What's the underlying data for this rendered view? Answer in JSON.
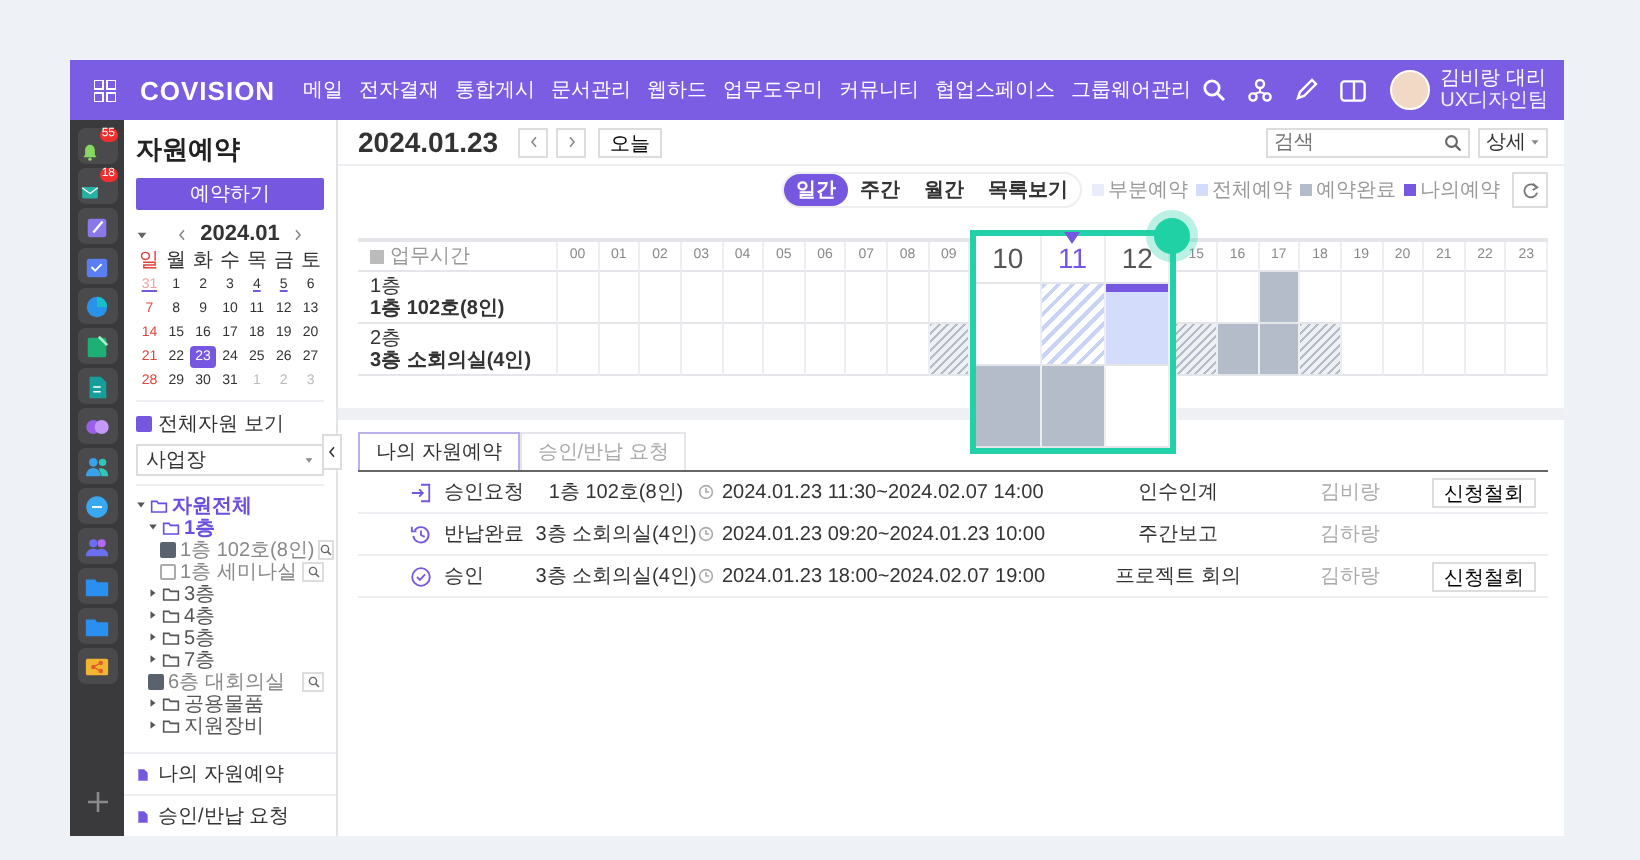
{
  "topbar": {
    "logo": "COVISION",
    "menu": [
      "메일",
      "전자결재",
      "통합게시",
      "문서관리",
      "웹하드",
      "업무도우미",
      "커뮤니티",
      "협업스페이스",
      "그룹웨어관리"
    ],
    "user_name": "김비랑 대리",
    "user_team": "UX디자인팀"
  },
  "rail": {
    "badges": [
      "55",
      "18"
    ]
  },
  "sidebar": {
    "title": "자원예약",
    "reserve_button": "예약하기",
    "calendar": {
      "month": "2024.01",
      "weekdays": [
        "일",
        "월",
        "화",
        "수",
        "목",
        "금",
        "토"
      ],
      "weeks": [
        [
          {
            "day": "31",
            "muted": true,
            "marked": true,
            "selected": false
          },
          {
            "day": "1",
            "muted": false,
            "marked": false,
            "selected": false
          },
          {
            "day": "2",
            "muted": false,
            "marked": false,
            "selected": false
          },
          {
            "day": "3",
            "muted": false,
            "marked": false,
            "selected": false
          },
          {
            "day": "4",
            "muted": false,
            "marked": true,
            "selected": false
          },
          {
            "day": "5",
            "muted": false,
            "marked": true,
            "selected": false
          },
          {
            "day": "6",
            "muted": false,
            "marked": false,
            "selected": false
          }
        ],
        [
          {
            "day": "7",
            "muted": false,
            "marked": false,
            "selected": false
          },
          {
            "day": "8",
            "muted": false,
            "marked": false,
            "selected": false
          },
          {
            "day": "9",
            "muted": false,
            "marked": false,
            "selected": false
          },
          {
            "day": "10",
            "muted": false,
            "marked": false,
            "selected": false
          },
          {
            "day": "11",
            "muted": false,
            "marked": false,
            "selected": false
          },
          {
            "day": "12",
            "muted": false,
            "marked": false,
            "selected": false
          },
          {
            "day": "13",
            "muted": false,
            "marked": false,
            "selected": false
          }
        ],
        [
          {
            "day": "14",
            "muted": false,
            "marked": false,
            "selected": false
          },
          {
            "day": "15",
            "muted": false,
            "marked": false,
            "selected": false
          },
          {
            "day": "16",
            "muted": false,
            "marked": false,
            "selected": false
          },
          {
            "day": "17",
            "muted": false,
            "marked": false,
            "selected": false
          },
          {
            "day": "18",
            "muted": false,
            "marked": false,
            "selected": false
          },
          {
            "day": "19",
            "muted": false,
            "marked": false,
            "selected": false
          },
          {
            "day": "20",
            "muted": false,
            "marked": false,
            "selected": false
          }
        ],
        [
          {
            "day": "21",
            "muted": false,
            "marked": false,
            "selected": false
          },
          {
            "day": "22",
            "muted": false,
            "marked": false,
            "selected": false
          },
          {
            "day": "23",
            "muted": false,
            "marked": false,
            "selected": true
          },
          {
            "day": "24",
            "muted": false,
            "marked": false,
            "selected": false
          },
          {
            "day": "25",
            "muted": false,
            "marked": false,
            "selected": false
          },
          {
            "day": "26",
            "muted": false,
            "marked": false,
            "selected": false
          },
          {
            "day": "27",
            "muted": false,
            "marked": false,
            "selected": false
          }
        ],
        [
          {
            "day": "28",
            "muted": false,
            "marked": false,
            "selected": false
          },
          {
            "day": "29",
            "muted": false,
            "marked": false,
            "selected": false
          },
          {
            "day": "30",
            "muted": false,
            "marked": false,
            "selected": false
          },
          {
            "day": "31",
            "muted": false,
            "marked": false,
            "selected": false
          },
          {
            "day": "1",
            "muted": true,
            "marked": false,
            "selected": false
          },
          {
            "day": "2",
            "muted": true,
            "marked": false,
            "selected": false
          },
          {
            "day": "3",
            "muted": true,
            "marked": false,
            "selected": false
          }
        ]
      ]
    },
    "show_all": {
      "label": "전체자원 보기",
      "checked": true
    },
    "site_select": {
      "value": "사업장"
    },
    "tree": [
      {
        "kind": "folder",
        "label": "자원전체",
        "expanded": true,
        "children": [
          {
            "kind": "folder",
            "label": "1층",
            "expanded": true,
            "children": [
              {
                "kind": "resource",
                "label": "1층 102호(8인)",
                "checked": true
              },
              {
                "kind": "resource",
                "label": "1층 세미나실",
                "checked": false
              }
            ]
          },
          {
            "kind": "folder",
            "label": "3층",
            "expanded": false
          },
          {
            "kind": "folder",
            "label": "4층",
            "expanded": false
          },
          {
            "kind": "folder",
            "label": "5층",
            "expanded": false
          },
          {
            "kind": "folder",
            "label": "7층",
            "expanded": false
          },
          {
            "kind": "resource",
            "label": "6층 대회의실",
            "checked": true
          },
          {
            "kind": "folder",
            "label": "공용물품",
            "expanded": false
          },
          {
            "kind": "folder",
            "label": "지원장비",
            "expanded": false
          }
        ]
      }
    ],
    "links": [
      "나의 자원예약",
      "승인/반납 요청"
    ]
  },
  "header": {
    "date": "2024.01.23",
    "today_button": "오늘",
    "search": {
      "placeholder": "검색"
    },
    "detail_button": "상세"
  },
  "views": [
    {
      "label": "일간",
      "selected": true
    },
    {
      "label": "주간",
      "selected": false
    },
    {
      "label": "월간",
      "selected": false
    },
    {
      "label": "목록보기",
      "selected": false
    }
  ],
  "legend": [
    {
      "label": "부분예약",
      "color": "#e8ecfb"
    },
    {
      "label": "전체예약",
      "color": "#d3dcfa"
    },
    {
      "label": "예약완료",
      "color": "#b3bcc8"
    },
    {
      "label": "나의예약",
      "color": "#7657e0"
    }
  ],
  "grid": {
    "corner_label": "업무시간",
    "hours_before": [
      "00",
      "01",
      "02",
      "03",
      "04",
      "05",
      "06",
      "07",
      "08",
      "09"
    ],
    "hours_after": [
      "15",
      "16",
      "17",
      "18",
      "19",
      "20",
      "21",
      "22",
      "23"
    ],
    "rows": [
      {
        "floor": "1층",
        "name": "1층 102호(8인)",
        "cells_before": [
          {
            "kind": "free"
          },
          {
            "kind": "free"
          },
          {
            "kind": "free"
          },
          {
            "kind": "free"
          },
          {
            "kind": "free"
          },
          {
            "kind": "free"
          },
          {
            "kind": "free"
          },
          {
            "kind": "free"
          },
          {
            "kind": "free"
          },
          {
            "kind": "free"
          }
        ],
        "cells_after": [
          {
            "kind": "free"
          },
          {
            "kind": "free"
          },
          {
            "kind": "done"
          },
          {
            "kind": "free"
          },
          {
            "kind": "free"
          },
          {
            "kind": "free"
          },
          {
            "kind": "free"
          },
          {
            "kind": "free"
          },
          {
            "kind": "free"
          }
        ]
      },
      {
        "floor": "2층",
        "name": "3층 소회의실(4인)",
        "cells_before": [
          {
            "kind": "free"
          },
          {
            "kind": "free"
          },
          {
            "kind": "free"
          },
          {
            "kind": "free"
          },
          {
            "kind": "free"
          },
          {
            "kind": "free"
          },
          {
            "kind": "free"
          },
          {
            "kind": "free"
          },
          {
            "kind": "free"
          },
          {
            "kind": "done-partial"
          }
        ],
        "cells_after": [
          {
            "kind": "done-partial"
          },
          {
            "kind": "done"
          },
          {
            "kind": "done"
          },
          {
            "kind": "done-partial"
          },
          {
            "kind": "free"
          },
          {
            "kind": "free"
          },
          {
            "kind": "free"
          },
          {
            "kind": "free"
          },
          {
            "kind": "free"
          }
        ]
      }
    ]
  },
  "magnifier": {
    "hours": [
      {
        "label": "10",
        "current": false
      },
      {
        "label": "11",
        "current": true
      },
      {
        "label": "12",
        "current": false
      }
    ],
    "rows": [
      [
        {
          "kind": "free"
        },
        {
          "kind": "partial"
        },
        {
          "kind": "mine"
        }
      ],
      [
        {
          "kind": "done"
        },
        {
          "kind": "done"
        },
        {
          "kind": "free"
        }
      ]
    ]
  },
  "tabs": [
    {
      "label": "나의 자원예약",
      "selected": true
    },
    {
      "label": "승인/반납 요청",
      "selected": false
    }
  ],
  "reservations": [
    {
      "kind": "request",
      "status": "승인요청",
      "resource": "1층 102호(8인)",
      "period": "2024.01.23 11:30~2024.02.07 14:00",
      "title": "인수인계",
      "owner": "김비랑",
      "action": "신청철회"
    },
    {
      "kind": "returned",
      "status": "반납완료",
      "resource": "3층 소회의실(4인)",
      "period": "2024.01.23 09:20~2024.01.23 10:00",
      "title": "주간보고",
      "owner": "김하랑"
    },
    {
      "kind": "approved",
      "status": "승인",
      "resource": "3층 소회의실(4인)",
      "period": "2024.01.23 18:00~2024.02.07 19:00",
      "title": "프로젝트 회의",
      "owner": "김하랑",
      "action": "신청철회"
    }
  ]
}
